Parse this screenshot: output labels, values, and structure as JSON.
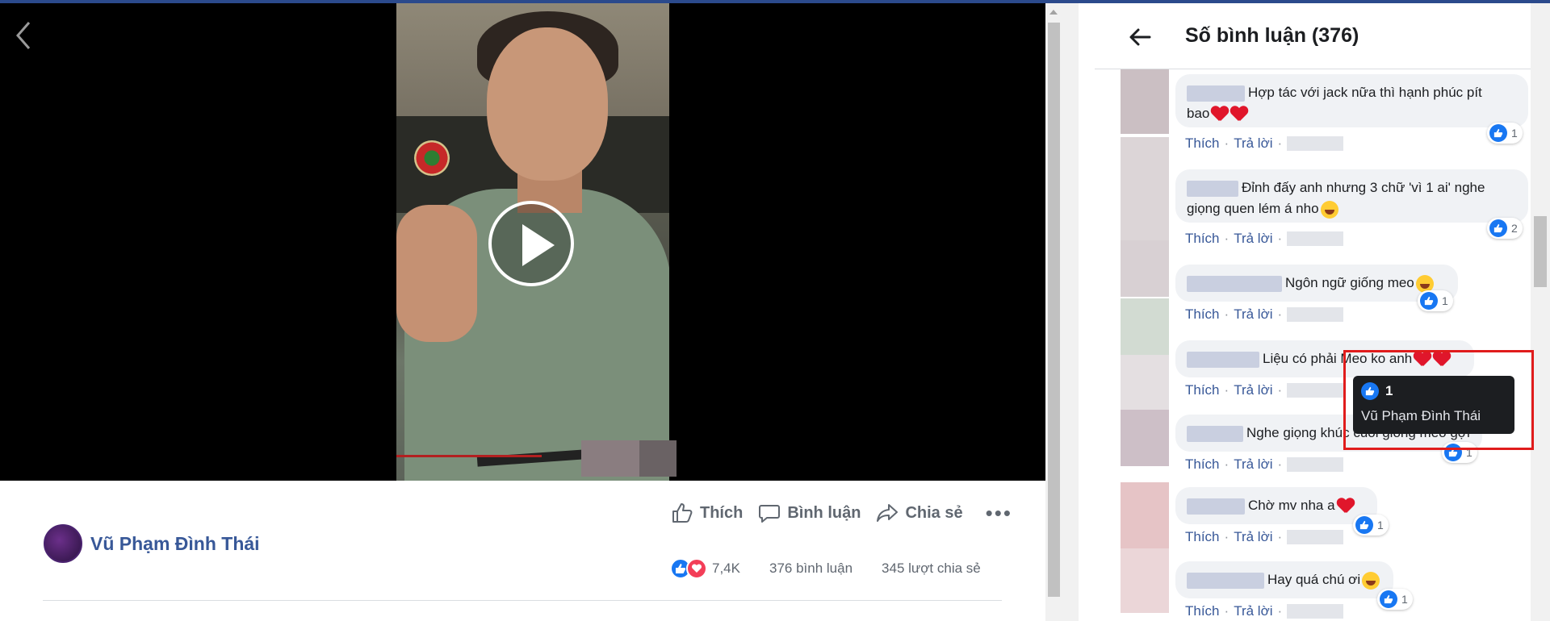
{
  "post": {
    "author_name": "Vũ Phạm Đình Thái",
    "actions": {
      "like": "Thích",
      "comment": "Bình luận",
      "share": "Chia sẻ"
    },
    "stats": {
      "reactions": "7,4K",
      "comments": "376 bình luận",
      "shares": "345 lượt chia sẻ"
    }
  },
  "panel": {
    "title": "Số bình luận (376)",
    "comments": [
      {
        "text_a": "Hợp tác với jack nữa thì hạnh phúc pít",
        "text_b": "bao",
        "tail": "hearts2",
        "likes": "1",
        "like_label": "Thích",
        "reply_label": "Trả lời"
      },
      {
        "text_a": "Đỉnh đấy anh nhưng 3 chữ 'vì 1 ai' nghe",
        "text_b": "giọng quen lém á nho",
        "tail": "laugh",
        "likes": "2",
        "like_label": "Thích",
        "reply_label": "Trả lời"
      },
      {
        "text_a": "Ngôn ngữ giống meo",
        "tail": "love-face",
        "likes": "1",
        "like_label": "Thích",
        "reply_label": "Trả lời"
      },
      {
        "text_a": "Liệu có phải Meo ko anh",
        "tail": "hearts2",
        "likes": "",
        "like_label": "Thích",
        "reply_label": "Trả lời"
      },
      {
        "text_a": "Nghe giọng khúc cuối giống meo gợi",
        "tail": "",
        "likes": "1",
        "like_label": "Thích",
        "reply_label": "Trả lời"
      },
      {
        "text_a": "Chờ mv nha a",
        "tail": "heart",
        "likes": "1",
        "like_label": "Thích",
        "reply_label": "Trả lời"
      },
      {
        "text_a": "Hay quá chú ơi",
        "tail": "love-face",
        "likes": "1",
        "like_label": "Thích",
        "reply_label": "Trả lời"
      }
    ]
  },
  "tooltip": {
    "count": "1",
    "person": "Vũ Phạm Đình Thái"
  },
  "colors": {
    "link": "#385898",
    "like_blue": "#1877f2",
    "love_red": "#f33e58",
    "highlight": "#e01c1c"
  }
}
